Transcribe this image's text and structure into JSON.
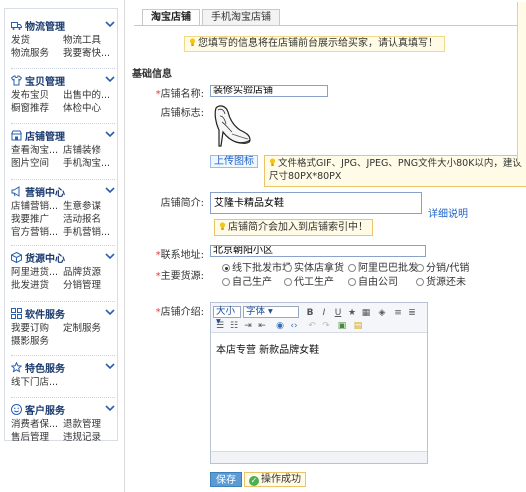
{
  "sidebar": {
    "sections": [
      {
        "title": "物流管理",
        "icon": "truck-icon",
        "rows": [
          [
            "发货",
            "物流工具"
          ],
          [
            "物流服务",
            "我要寄快..."
          ]
        ]
      },
      {
        "title": "宝贝管理",
        "icon": "shirt-icon",
        "rows": [
          [
            "发布宝贝",
            "出售中的..."
          ],
          [
            "橱窗推荐",
            "体检中心"
          ]
        ]
      },
      {
        "title": "店铺管理",
        "icon": "store-icon",
        "rows": [
          [
            "查看淘宝...",
            "店铺装修"
          ],
          [
            "图片空间",
            "手机淘宝..."
          ]
        ]
      },
      {
        "title": "营销中心",
        "icon": "megaphone-icon",
        "rows": [
          [
            "店铺营销...",
            "生意参谋"
          ],
          [
            "我要推广",
            "活动报名"
          ],
          [
            "官方营销...",
            "手机营销..."
          ]
        ]
      },
      {
        "title": "货源中心",
        "icon": "box-icon",
        "rows": [
          [
            "阿里进货...",
            "品牌货源"
          ],
          [
            "批发进货",
            "分销管理"
          ]
        ]
      },
      {
        "title": "软件服务",
        "icon": "grid-icon",
        "rows": [
          [
            "我要订购",
            "定制服务"
          ],
          [
            "摄影服务",
            ""
          ]
        ]
      },
      {
        "title": "特色服务",
        "icon": "star-icon",
        "rows": [
          [
            "线下门店...",
            ""
          ]
        ]
      },
      {
        "title": "客户服务",
        "icon": "smile-icon",
        "rows": [
          [
            "消费者保...",
            "退款管理"
          ],
          [
            "售后管理",
            "违规记录"
          ]
        ]
      }
    ]
  },
  "tabs": [
    "淘宝店铺",
    "手机淘宝店铺"
  ],
  "notice": "您填写的信息将在店铺前台展示给买家，请认真填写！",
  "section_heading": "基础信息",
  "form": {
    "name_label": "店铺名称:",
    "name_value": "装修实验店铺",
    "logo_label": "店铺标志:",
    "upload_label": "上传图标",
    "upload_tip": "文件格式GIF、JPG、JPEG、PNG文件大小80K以内，建议尺寸80PX*80PX",
    "intro_label": "店铺简介:",
    "intro_value": "艾隆卡精品女鞋",
    "detail_link": "详细说明",
    "intro_hint": "店铺简介会加入到店铺索引中！",
    "address_label": "联系地址:",
    "address_value": "北京朝阳小区",
    "source_label": "主要货源:",
    "source_options": [
      "线下批发市场",
      "实体店拿货",
      "阿里巴巴批发",
      "分销/代销",
      "自己生产",
      "代工生产",
      "自由公司",
      "货源还未"
    ],
    "source_selected": 0,
    "desc_label": "店铺介绍:",
    "editor_size": "大小",
    "editor_font": "字体",
    "editor_content": "本店专营  新款品牌女鞋"
  },
  "buttons": {
    "save": "保存",
    "success": "操作成功"
  },
  "colors": {
    "accent": "#1f62c5",
    "notice_bg": "#fffbe6",
    "required": "#e4393c",
    "save_bg": "#5a9bd5"
  }
}
